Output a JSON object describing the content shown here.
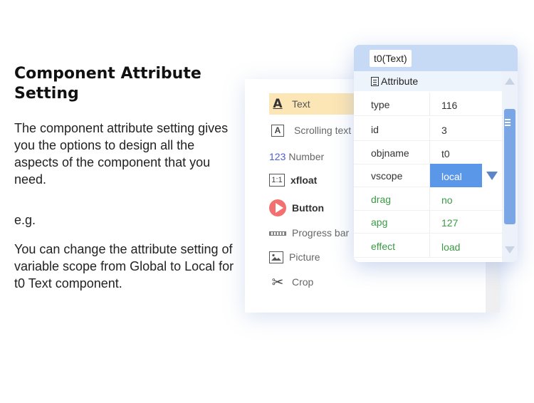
{
  "intro": {
    "title": "Component Attribute Setting",
    "description": "The component attribute setting gives you the options to design all the aspects of the component that you need.",
    "eg": "e.g.",
    "example": "You can change the attribute setting of variable scope from Global to Local for t0 Text component."
  },
  "components": [
    {
      "label": "Text",
      "icon": "text-icon"
    },
    {
      "label": "Scrolling text",
      "icon": "scrolling-text-icon"
    },
    {
      "label": "Number",
      "icon": "number-icon",
      "icon_text": "123"
    },
    {
      "label": "xfloat",
      "icon": "xfloat-icon",
      "icon_text": "1:1"
    },
    {
      "label": "Button",
      "icon": "button-icon"
    },
    {
      "label": "Progress bar",
      "icon": "progress-bar-icon"
    },
    {
      "label": "Picture",
      "icon": "picture-icon"
    },
    {
      "label": "Crop",
      "icon": "scissors-icon"
    }
  ],
  "attributes": {
    "tab": "t0(Text)",
    "section": "Attribute",
    "rows": [
      {
        "key": "type",
        "value": "116"
      },
      {
        "key": "id",
        "value": "3"
      },
      {
        "key": "objname",
        "value": "t0"
      },
      {
        "key": "vscope",
        "value": "local"
      },
      {
        "key": "drag",
        "value": "no"
      },
      {
        "key": "apg",
        "value": "127"
      },
      {
        "key": "effect",
        "value": "load"
      }
    ]
  },
  "colors": {
    "selected_item": "#fde6b5",
    "attr_header": "#c6d9f5",
    "selected_value": "#5b97e8",
    "green_text": "#3a9a45"
  }
}
